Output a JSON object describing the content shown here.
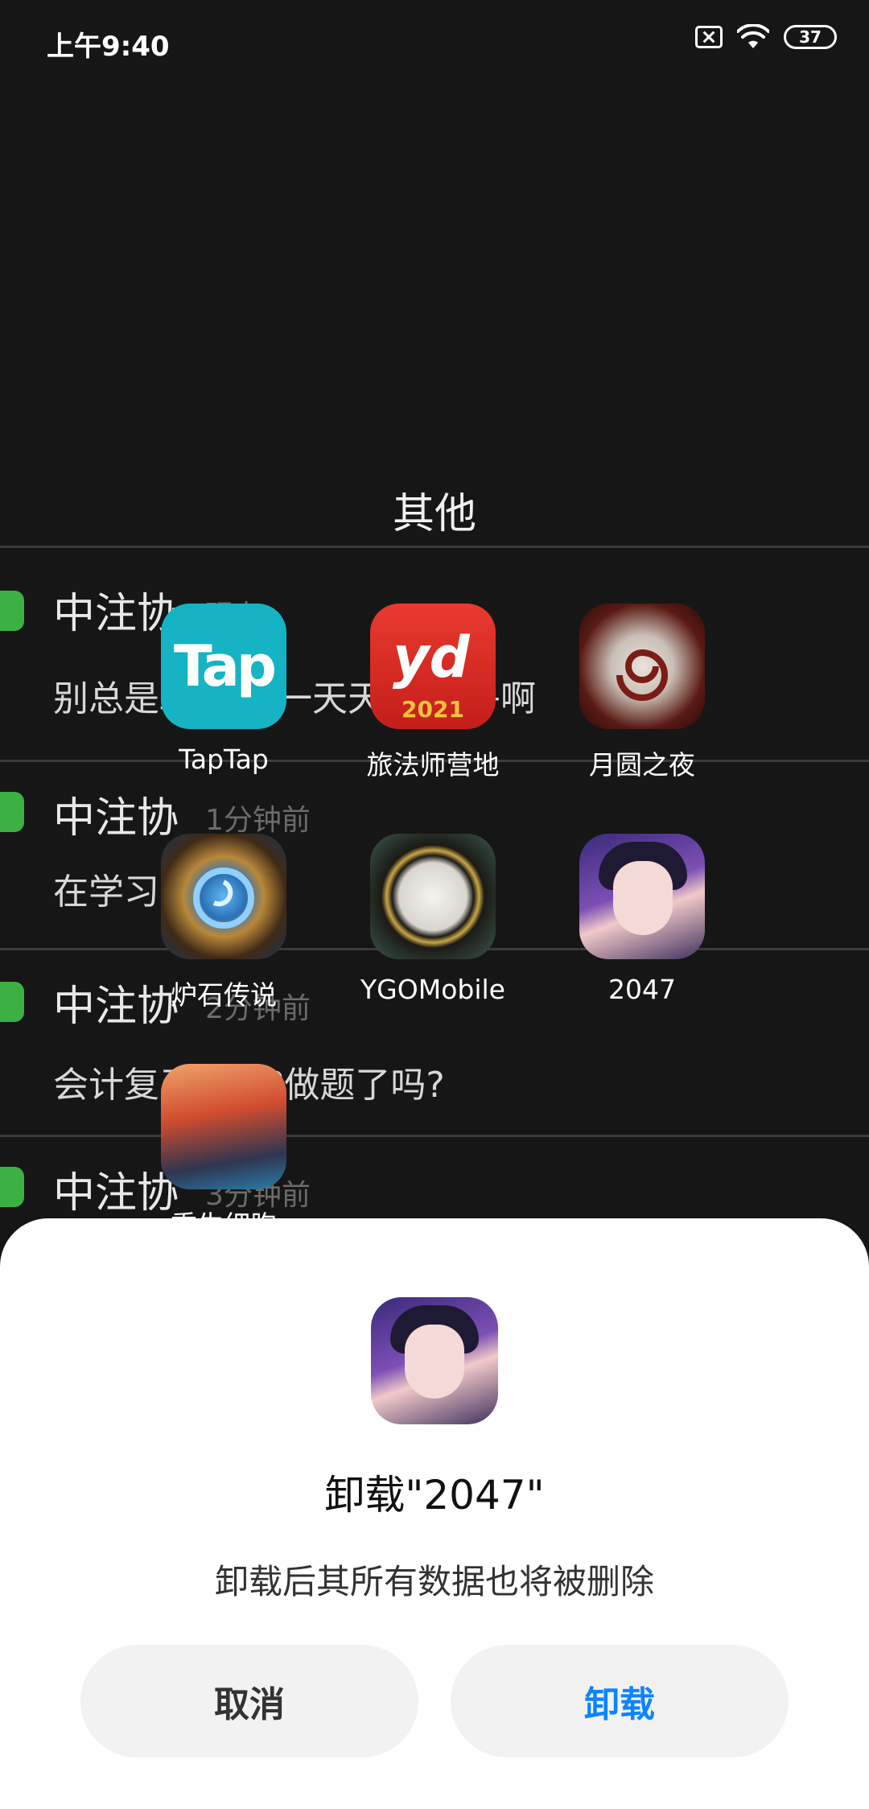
{
  "status_bar": {
    "time": "上午9:40",
    "battery": "37",
    "icons": [
      "sim-off-icon",
      "wifi-icon",
      "battery-icon"
    ]
  },
  "background_messages": [
    {
      "sender": "中注协",
      "time": "现在",
      "text": "别总是玩手机,一天天的,乎乎啊"
    },
    {
      "sender": "中注协",
      "time": "1分钟前",
      "text": "在学习吗"
    },
    {
      "sender": "中注协",
      "time": "2分钟前",
      "text": "会计复习了吗?做题了吗?"
    },
    {
      "sender": "中注协",
      "time": "3分钟前",
      "text": ""
    }
  ],
  "folder": {
    "title": "其他",
    "apps": [
      {
        "name": "TapTap",
        "icon": "taptap-icon"
      },
      {
        "name": "旅法师营地",
        "icon": "yd-camp-icon"
      },
      {
        "name": "月圆之夜",
        "icon": "moon-night-icon"
      },
      {
        "name": "炉石传说",
        "icon": "hearthstone-icon"
      },
      {
        "name": "YGOMobile",
        "icon": "ygomobile-icon"
      },
      {
        "name": "2047",
        "icon": "app-2047-icon"
      },
      {
        "name": "重生细胞",
        "icon": "dead-cells-icon"
      }
    ],
    "taptap_logo_text": "Tap",
    "yd_logo_text": "yd",
    "yd_year": "2021"
  },
  "dialog": {
    "app_icon": "app-2047-icon",
    "title": "卸载\"2047\"",
    "description": "卸载后其所有数据也将被删除",
    "cancel_label": "取消",
    "uninstall_label": "卸载",
    "accent_color": "#0d84ff"
  }
}
